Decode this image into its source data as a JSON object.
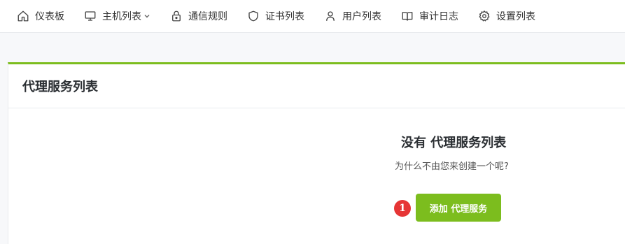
{
  "nav": {
    "items": [
      {
        "label": "仪表板",
        "icon": "home-icon"
      },
      {
        "label": "主机列表",
        "icon": "monitor-icon",
        "has_dropdown": true
      },
      {
        "label": "通信规则",
        "icon": "lock-icon"
      },
      {
        "label": "证书列表",
        "icon": "shield-icon"
      },
      {
        "label": "用户列表",
        "icon": "user-icon"
      },
      {
        "label": "审计日志",
        "icon": "book-icon"
      },
      {
        "label": "设置列表",
        "icon": "gear-icon"
      }
    ]
  },
  "card": {
    "title": "代理服务列表"
  },
  "empty_state": {
    "title": "没有 代理服务列表",
    "subtitle": "为什么不由您来创建一个呢?",
    "add_button_label": "添加 代理服务"
  },
  "annotation": {
    "badge_number": "1"
  },
  "colors": {
    "accent": "#7cbd1e",
    "badge": "#e63535",
    "text": "#333333"
  }
}
